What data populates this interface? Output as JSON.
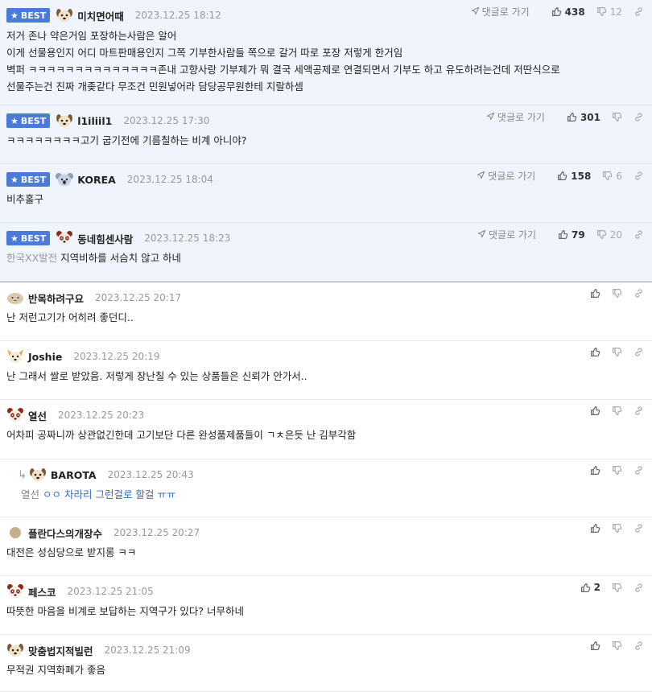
{
  "reply_label": "댓글로 가기",
  "comments": [
    {
      "best": true,
      "badge": "BEST",
      "nick": "미치면어때",
      "date": "2023.12.25 18:12",
      "up": "438",
      "down": "12",
      "lines": [
        "저거 존나 약은거임 포장하는사람은 알어",
        "이게 선물용인지 어디 마트판매용인지 그쪽 기부한사람들 쪽으로 갈거 따로 포장 저렇게 한거임",
        "벽퍼 ㅋㅋㅋㅋㅋㅋㅋㅋㅋㅋㅋㅋㅋㅋ존내 고향사랑 기부제가 뭐 결국 세액공제로 연결되면서 기부도 하고 유도하려는건데 저딴식으로",
        "선물주는건 진짜 개좆같다 무조건 민원넣어라 담당공무원한테 지랄하셈"
      ]
    },
    {
      "best": true,
      "badge": "BEST",
      "nick": "l1iliil1",
      "date": "2023.12.25 17:30",
      "up": "301",
      "down": "",
      "lines": [
        "ㅋㅋㅋㅋㅋㅋㅋㅋ고기 굽기전에 기름칠하는 비계 아니야?"
      ]
    },
    {
      "best": true,
      "badge": "BEST",
      "nick": "KOREA",
      "date": "2023.12.25 18:04",
      "up": "158",
      "down": "6",
      "lines": [
        "비추홀구"
      ]
    },
    {
      "best": true,
      "badge": "BEST",
      "nick": "동네힘센사람",
      "date": "2023.12.25 18:23",
      "up": "79",
      "down": "20",
      "mention": "한국XX발전",
      "lines": [
        "지역비하를 서슴치 않고 하네"
      ]
    },
    {
      "best": false,
      "nick": "반목하려구요",
      "date": "2023.12.25 20:17",
      "up": "",
      "lines": [
        "난 저런고기가 어히려 좋던디.."
      ]
    },
    {
      "best": false,
      "nick": "Joshie",
      "date": "2023.12.25 20:19",
      "up": "",
      "lines": [
        "난 그래서 쌀로 받았음. 저렇게 장난칠 수 있는 상품들은 신뢰가 안가서.."
      ]
    },
    {
      "best": false,
      "nick": "열선",
      "date": "2023.12.25 20:23",
      "up": "",
      "lines": [
        "어차피 공짜니까 상관없긴한데 고기보단 다른 완성품제품들이 ㄱㅊ은듯 난 김부각함"
      ]
    },
    {
      "best": false,
      "reply": true,
      "nick": "BAROTA",
      "date": "2023.12.25 20:43",
      "up": "",
      "mention": "열선",
      "lines": [
        "ㅇㅇ 차라리 그런걸로 할걸 ㅠㅠ"
      ]
    },
    {
      "best": false,
      "nick": "플란다스의개장수",
      "date": "2023.12.25 20:27",
      "up": "",
      "lines": [
        "대전은 성심당으로 받지롱 ㅋㅋ"
      ]
    },
    {
      "best": false,
      "nick": "페스코",
      "date": "2023.12.25 21:05",
      "up": "2",
      "lines": [
        "따뜻한 마음을 비계로 보답하는 지역구가 있다? 너무하네"
      ]
    },
    {
      "best": false,
      "nick": "맞춤법지적빌런",
      "date": "2023.12.25 21:09",
      "up": "",
      "lines": [
        "무적권 지역화폐가 좋음"
      ]
    }
  ]
}
